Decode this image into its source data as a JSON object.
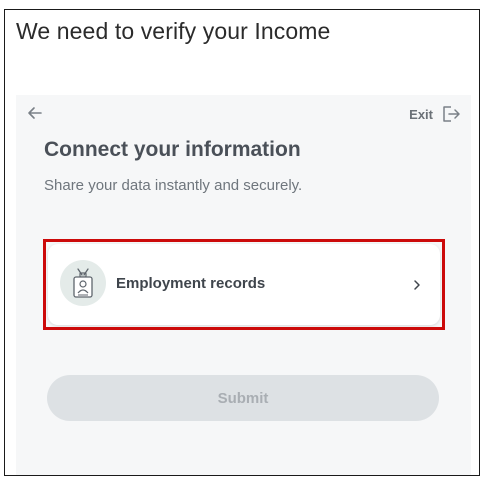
{
  "page": {
    "title": "We need to verify your Income"
  },
  "panel": {
    "back_icon": "arrow-left-icon",
    "exit_label": "Exit",
    "exit_icon": "exit-door-icon",
    "title": "Connect your information",
    "subtitle": "Share your data instantly and securely."
  },
  "option": {
    "icon": "id-badge-icon",
    "label": "Employment records",
    "chevron": "chevron-right-icon",
    "highlight_color": "#cc0a0a"
  },
  "submit": {
    "label": "Submit",
    "state": "disabled"
  }
}
